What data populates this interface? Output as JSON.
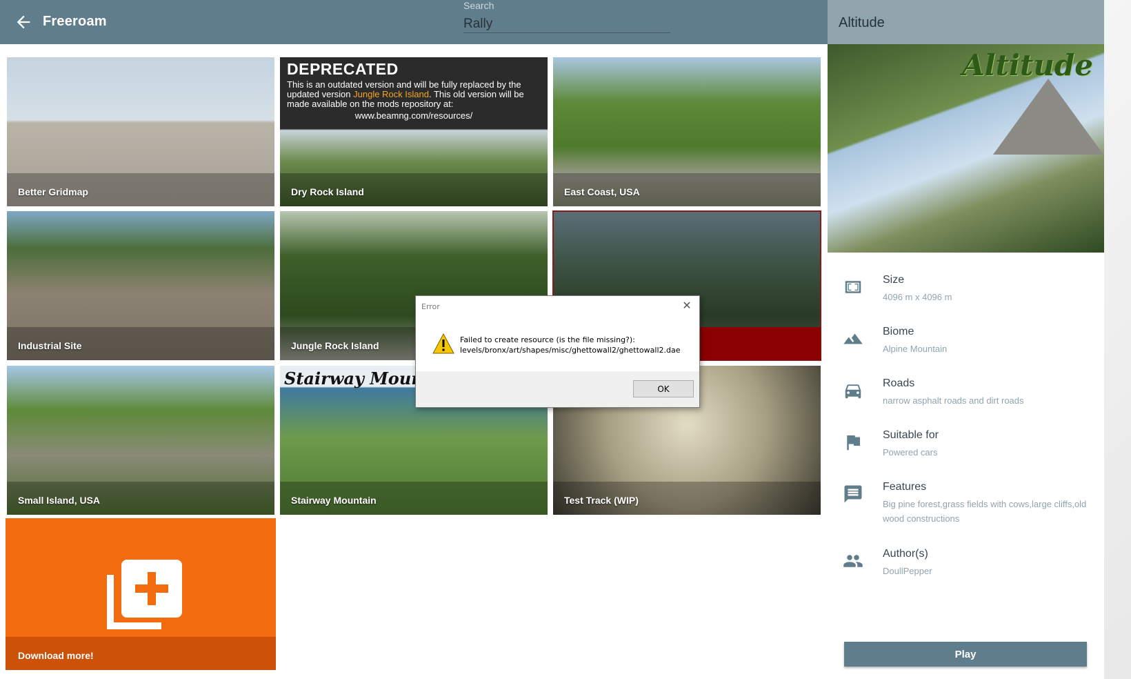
{
  "header": {
    "back_icon": "arrow-left-icon",
    "title": "Freeroam",
    "search_label": "Search",
    "search_value": "Rally"
  },
  "tiles": [
    {
      "name": "Better Gridmap"
    },
    {
      "name": "Dry Rock Island"
    },
    {
      "name": "East Coast, USA"
    },
    {
      "name": "Industrial Site"
    },
    {
      "name": "Jungle Rock Island"
    },
    {
      "name": ""
    },
    {
      "name": "Small Island, USA"
    },
    {
      "name": "Stairway Mountain"
    },
    {
      "name": "Test Track (WIP)"
    }
  ],
  "deprecated_banner": {
    "title": "DEPRECATED",
    "text_before": "This is an outdated version and will be fully replaced by the updated version ",
    "link_text": "Jungle Rock Island",
    "text_after": ". This old version will be made available on the mods repository at:",
    "url": "www.beamng.com/resources/"
  },
  "stairway_logo": "Stairway Mountai",
  "download_tile": {
    "label": "Download more!",
    "icon": "library-add-icon"
  },
  "details": {
    "title": "Altitude",
    "preview_logo": "Altitude",
    "rows": [
      {
        "icon": "size-icon",
        "label": "Size",
        "value": "4096 m x 4096 m"
      },
      {
        "icon": "terrain-icon",
        "label": "Biome",
        "value": "Alpine Mountain"
      },
      {
        "icon": "car-icon",
        "label": "Roads",
        "value": "narrow asphalt roads and dirt roads"
      },
      {
        "icon": "flag-icon",
        "label": "Suitable for",
        "value": "Powered cars"
      },
      {
        "icon": "message-icon",
        "label": "Features",
        "value": "Big pine forest,grass fields with cows,large cliffs,old wood constructions"
      },
      {
        "icon": "people-icon",
        "label": "Author(s)",
        "value": "DoullPepper"
      }
    ],
    "play_label": "Play"
  },
  "dialog": {
    "title": "Error",
    "line1": "Failed to create resource (is the file missing?):",
    "line2": "levels/bronx/art/shapes/misc/ghettowall2/ghettowall2.dae",
    "ok_label": "OK"
  },
  "colors": {
    "header": "#607d8b",
    "panel_header": "#90a4ae",
    "download_tile": "#f26b0f",
    "selected_bar": "#8b0000",
    "play_button": "#607d8b"
  }
}
